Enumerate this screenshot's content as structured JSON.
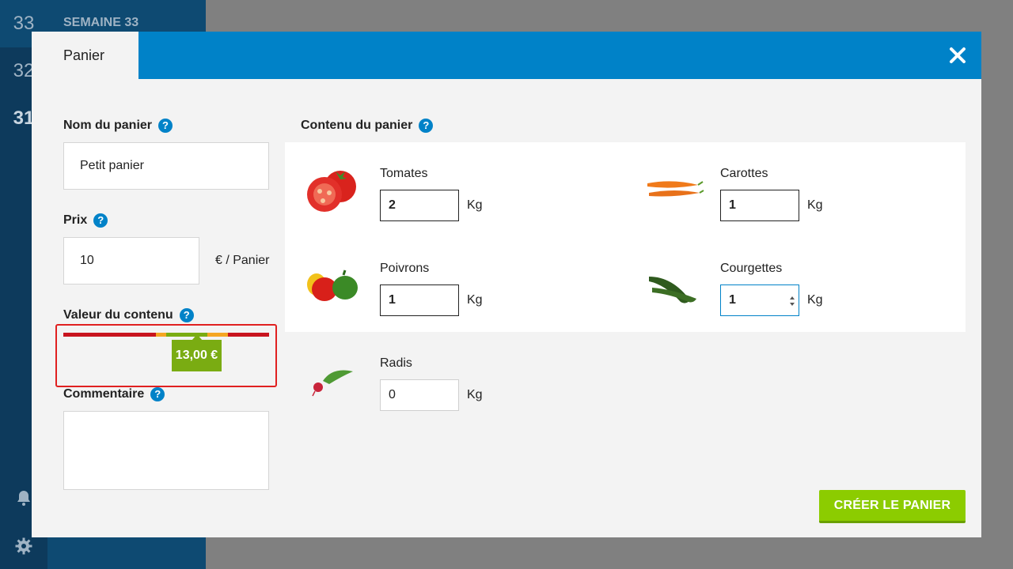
{
  "background": {
    "weeks": [
      "33",
      "32",
      "31"
    ],
    "week_title": "SEMAINE 33"
  },
  "modal": {
    "tab_label": "Panier",
    "basket_name": {
      "label": "Nom du panier",
      "value": "Petit panier"
    },
    "price": {
      "label": "Prix",
      "value": "10",
      "unit": "€ / Panier"
    },
    "content_value": {
      "label": "Valeur du contenu",
      "value": "13,00 €"
    },
    "comment": {
      "label": "Commentaire",
      "value": ""
    },
    "content": {
      "label": "Contenu du panier",
      "items": [
        {
          "name": "Tomates",
          "qty": "2",
          "unit": "Kg"
        },
        {
          "name": "Carottes",
          "qty": "1",
          "unit": "Kg"
        },
        {
          "name": "Poivrons",
          "qty": "1",
          "unit": "Kg"
        },
        {
          "name": "Courgettes",
          "qty": "1",
          "unit": "Kg"
        },
        {
          "name": "Radis",
          "qty": "0",
          "unit": "Kg"
        }
      ]
    },
    "create_button": "CRÉER LE PANIER",
    "help_glyph": "?"
  },
  "colors": {
    "accent": "#0082c8",
    "gauge_red": "#c8141e",
    "gauge_orange": "#f5a623",
    "gauge_green": "#7aac12",
    "button_green": "#8ccc00"
  }
}
